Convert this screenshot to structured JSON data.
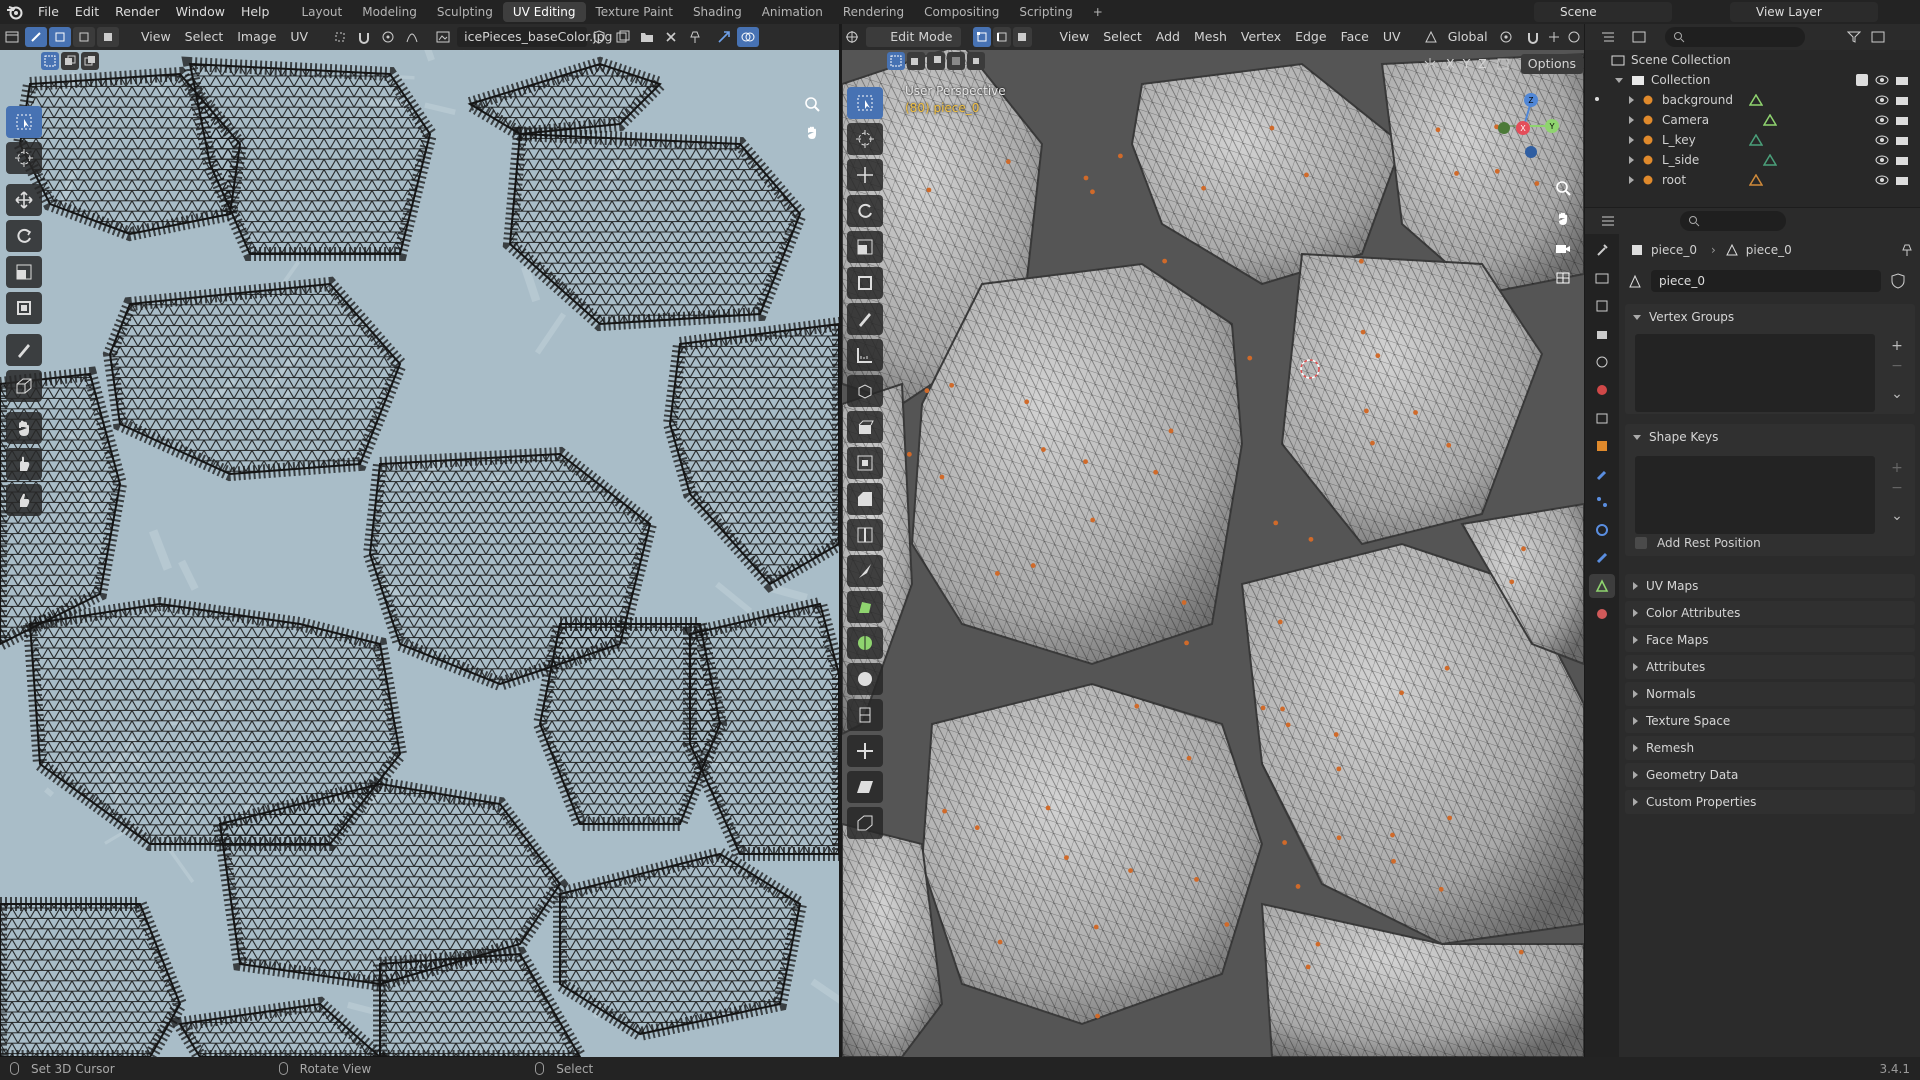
{
  "topbar": {
    "menu": [
      "File",
      "Edit",
      "Render",
      "Window",
      "Help"
    ],
    "workspaces": [
      "Layout",
      "Modeling",
      "Sculpting",
      "UV Editing",
      "Texture Paint",
      "Shading",
      "Animation",
      "Rendering",
      "Compositing",
      "Scripting"
    ],
    "active_workspace": "UV Editing",
    "add_tab": "+",
    "scene": "Scene",
    "view_layer": "View Layer"
  },
  "uv_editor": {
    "menus": [
      "View",
      "Select",
      "Image",
      "UV"
    ],
    "image_name": "icePieces_baseColor.jpg",
    "bg_color": "#a9bdc8",
    "wire_color": "#151515"
  },
  "viewport": {
    "mode": "Edit Mode",
    "menus": [
      "View",
      "Select",
      "Add",
      "Mesh",
      "Vertex",
      "Edge",
      "Face",
      "UV"
    ],
    "orientation": "Global",
    "axes": [
      "X",
      "Y",
      "Z"
    ],
    "options": "Options",
    "overlay_title": "User Perspective",
    "overlay_object": "(80) piece_0",
    "mesh_color": "#bdbdbd",
    "gizmo": {
      "x": "X",
      "y": "Y",
      "z": "Z"
    }
  },
  "outliner": {
    "root": "Scene Collection",
    "collection": "Collection",
    "items": [
      {
        "name": "background"
      },
      {
        "name": "Camera"
      },
      {
        "name": "L_key"
      },
      {
        "name": "L_side"
      },
      {
        "name": "root"
      }
    ]
  },
  "properties": {
    "breadcrumb_object": "piece_0",
    "breadcrumb_mesh": "piece_0",
    "datablock": "piece_0",
    "vertex_groups": "Vertex Groups",
    "shape_keys": "Shape Keys",
    "add_rest_position": "Add Rest Position",
    "collapsed_panels": [
      "UV Maps",
      "Color Attributes",
      "Face Maps",
      "Attributes",
      "Normals",
      "Texture Space",
      "Remesh",
      "Geometry Data",
      "Custom Properties"
    ]
  },
  "statusbar": {
    "items": [
      "Set 3D Cursor",
      "Rotate View",
      "Select"
    ],
    "version": "3.4.1"
  },
  "colors": {
    "accent": "#4772b3",
    "header": "#2b2b2b",
    "panel": "#303030"
  }
}
